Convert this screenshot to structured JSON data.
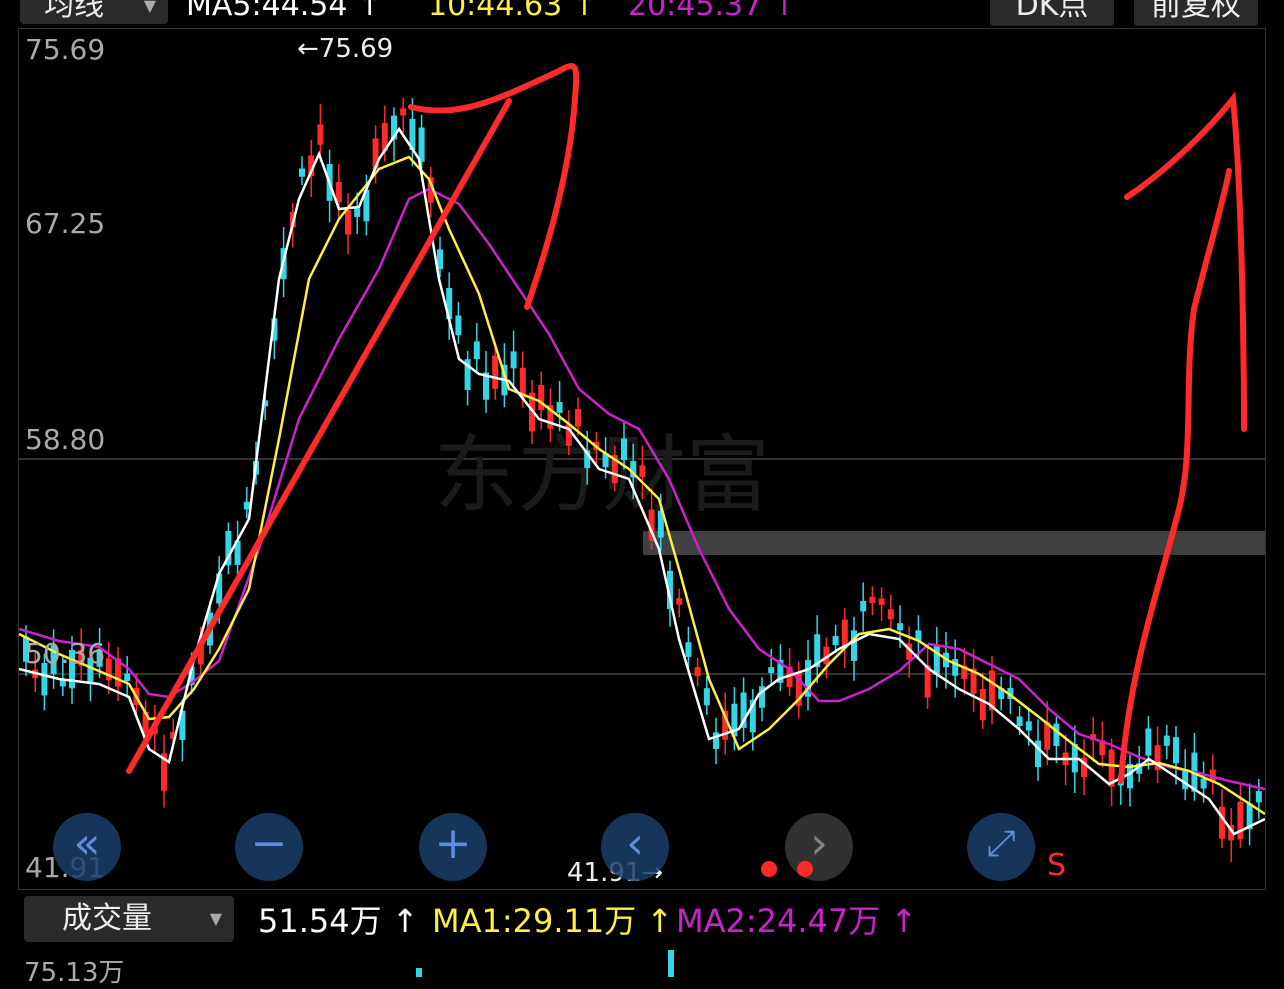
{
  "toolbar": {
    "indicator_select": "均线",
    "ma5": "MA5:44.54 ↑",
    "ma10": "10:44.63 ↑",
    "ma20": "20:45.37 ↑",
    "dk_button": "DK点",
    "adjust_button": "前复权"
  },
  "price_axis": {
    "labels": [
      "75.69",
      "67.25",
      "58.80",
      "50.36",
      "41.91"
    ]
  },
  "annotations": {
    "high": "←75.69",
    "low": "41.91→",
    "sell_marker": "S",
    "watermark": "东方财富"
  },
  "controls": {
    "rewind": "«",
    "zoom_out": "−",
    "zoom_in": "+",
    "prev": "‹",
    "next": "›",
    "expand": "⤢"
  },
  "volume": {
    "select": "成交量",
    "value": "51.54万 ↑",
    "ma1": "MA1:29.11万 ↑",
    "ma2": "MA2:24.47万 ↑",
    "axis_top": "75.13万"
  },
  "colors": {
    "up": "#ff2a2a",
    "down": "#33d6e6",
    "ma5": "#ffffff",
    "ma10": "#ffee44",
    "ma20": "#cc22cc",
    "accent": "#6fa8ff"
  }
}
